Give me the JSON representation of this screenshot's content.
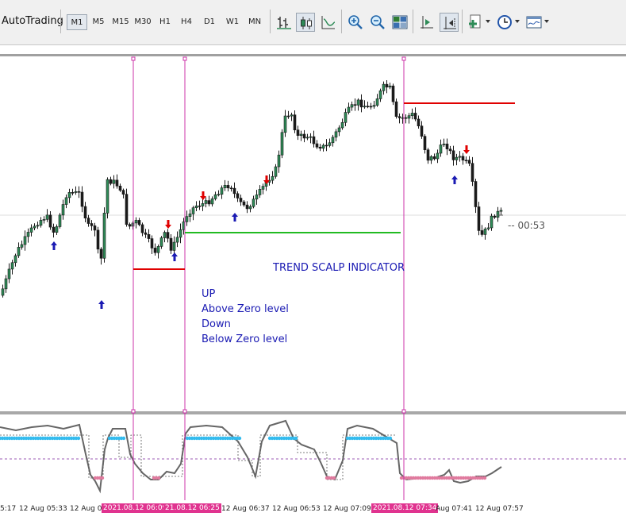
{
  "toolbar": {
    "autotrading_label": "AutoTrading",
    "timeframes": [
      "M1",
      "M5",
      "M15",
      "M30",
      "H1",
      "H4",
      "D1",
      "W1",
      "MN"
    ],
    "active_timeframe": "M1"
  },
  "chart": {
    "countdown": "-- 00:53",
    "title": "TREND SCALP INDICATOR",
    "legend": [
      "UP",
      "Above Zero level",
      "Down",
      "Below Zero level"
    ],
    "colors": {
      "candle": "#1a1a1a",
      "vline": "#cc33aa",
      "level_red": "#e00000",
      "level_green": "#22bb22",
      "arrow_up": "#1a1ab3",
      "arrow_down": "#e00000",
      "osc_up": "#33bbee",
      "osc_down": "#e07a9e",
      "osc_line": "#666666"
    }
  },
  "time_axis": {
    "labels": [
      "5:17",
      "12 Aug 05:33",
      "12 Aug 05",
      "2021.08.12 06:09",
      "21.08.12 06:25",
      "12 Aug 06:37",
      "12 Aug 06:53",
      "12 Aug 07:09",
      "2021.08.12 07:34",
      "Aug 07:41",
      "12 Aug 07:57"
    ]
  }
}
